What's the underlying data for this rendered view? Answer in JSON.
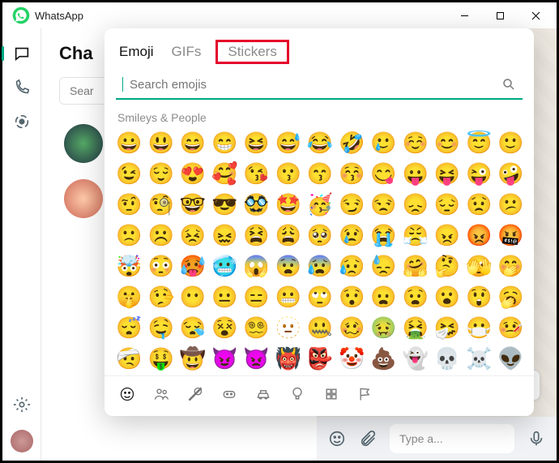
{
  "titlebar": {
    "app_name": "WhatsApp"
  },
  "chats": {
    "heading": "Cha",
    "search_placeholder": "Sear"
  },
  "composer": {
    "placeholder": "Type a..."
  },
  "emoji_panel": {
    "tabs": {
      "emoji": "Emoji",
      "gifs": "GIFs",
      "stickers": "Stickers"
    },
    "search_placeholder": "Search emojis",
    "category_label": "Smileys & People",
    "emojis": [
      "😀",
      "😃",
      "😄",
      "😁",
      "😆",
      "😅",
      "😂",
      "🤣",
      "🥲",
      "☺️",
      "😊",
      "😇",
      "🙂",
      "😉",
      "😌",
      "😍",
      "🥰",
      "😘",
      "😗",
      "😙",
      "😚",
      "😋",
      "😛",
      "😝",
      "😜",
      "🤪",
      "🤨",
      "🧐",
      "🤓",
      "😎",
      "🥸",
      "🤩",
      "🥳",
      "😏",
      "😒",
      "😞",
      "😔",
      "😟",
      "😕",
      "🙁",
      "☹️",
      "😣",
      "😖",
      "😫",
      "😩",
      "🥺",
      "😢",
      "😭",
      "😤",
      "😠",
      "😡",
      "🤬",
      "🤯",
      "😳",
      "🥵",
      "🥶",
      "😱",
      "😨",
      "😰",
      "😥",
      "😓",
      "🤗",
      "🤔",
      "🫣",
      "🤭",
      "🤫",
      "🤥",
      "😶",
      "😐",
      "😑",
      "😬",
      "🙄",
      "😯",
      "😦",
      "😧",
      "😮",
      "😲",
      "🥱",
      "😴",
      "🤤",
      "😪",
      "😵",
      "😵‍💫",
      "🫥",
      "🤐",
      "🥴",
      "🤢",
      "🤮",
      "🤧",
      "😷",
      "🤒",
      "🤕",
      "🤑",
      "🤠",
      "😈",
      "👿",
      "👹",
      "👺",
      "🤡",
      "💩",
      "👻",
      "💀",
      "☠️",
      "👽"
    ],
    "categories": [
      "smileys",
      "people",
      "food",
      "activity",
      "travel",
      "objects",
      "symbols",
      "flags"
    ]
  }
}
